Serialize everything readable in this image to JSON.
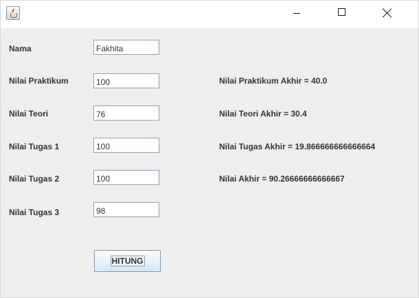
{
  "titlebar": {
    "icon": "java-app-icon",
    "controls": [
      "minimize-icon",
      "maximize-icon",
      "close-icon"
    ]
  },
  "form": {
    "nama_label": "Nama",
    "nama_value": "Fakhita",
    "praktikum_label": "Nilai Praktikum",
    "praktikum_value": "100",
    "teori_label": "Nilai Teori",
    "teori_value": "76",
    "tugas1_label": "Nilai Tugas 1",
    "tugas1_value": "100",
    "tugas2_label": "Nilai Tugas 2",
    "tugas2_value": "100",
    "tugas3_label": "Nilai Tugas 3",
    "tugas3_value": "98",
    "button_label": "HITUNG"
  },
  "results": {
    "praktikum": "Nilai Praktikum Akhir = 40.0",
    "teori": "Nilai Teori Akhir = 30.4",
    "tugas": "Nilai Tugas Akhir = 19.866666666666664",
    "akhir": "Nilai Akhir = 90.26666666666667"
  }
}
